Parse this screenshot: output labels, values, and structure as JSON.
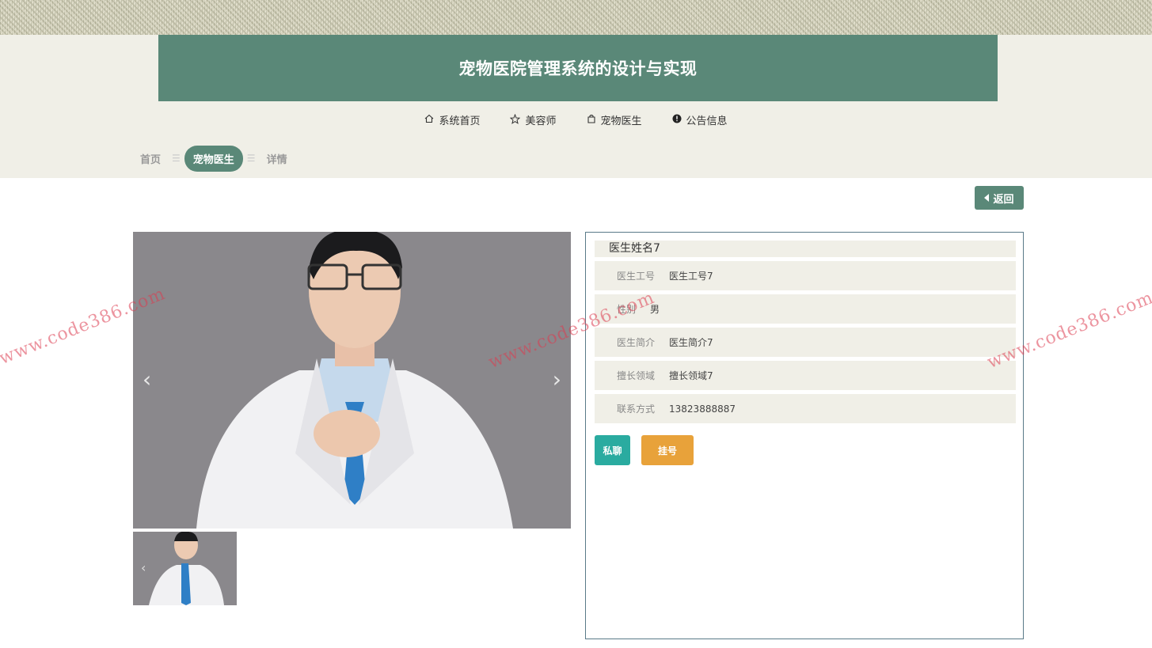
{
  "header": {
    "title": "宠物医院管理系统的设计与实现"
  },
  "nav": [
    {
      "label": "系统首页",
      "icon": "home-icon"
    },
    {
      "label": "美容师",
      "icon": "star-icon"
    },
    {
      "label": "宠物医生",
      "icon": "bag-icon"
    },
    {
      "label": "公告信息",
      "icon": "info-icon"
    }
  ],
  "breadcrumb": {
    "home": "首页",
    "current": "宠物医生",
    "detail": "详情"
  },
  "back_label": "返回",
  "gallery": {
    "prev_glyph": "‹",
    "next_glyph": "›"
  },
  "doctor": {
    "name": "医生姓名7",
    "fields": [
      {
        "label": "医生工号",
        "value": "医生工号7"
      },
      {
        "label": "性别",
        "value": "男"
      },
      {
        "label": "医生简介",
        "value": "医生简介7"
      },
      {
        "label": "擅长领域",
        "value": "擅长领域7"
      },
      {
        "label": "联系方式",
        "value": "13823888887"
      }
    ]
  },
  "actions": {
    "chat": "私聊",
    "register": "挂号"
  },
  "watermark": "www.code386.com",
  "colors": {
    "primary": "#5a8878",
    "chat": "#2aaba0",
    "register": "#e8a23a",
    "band": "#f0efe7"
  }
}
